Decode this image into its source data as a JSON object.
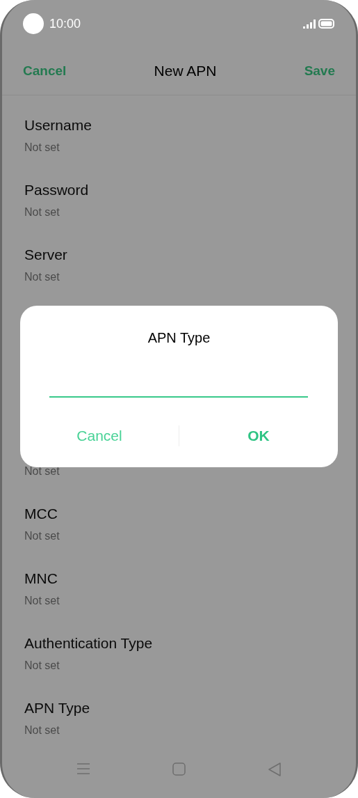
{
  "status_bar": {
    "time": "10:00"
  },
  "header": {
    "cancel": "Cancel",
    "title": "New APN",
    "save": "Save"
  },
  "fields": [
    {
      "title": "Username",
      "value": "Not set"
    },
    {
      "title": "Password",
      "value": "Not set"
    },
    {
      "title": "Server",
      "value": "Not set"
    },
    {
      "value": "Not set"
    },
    {
      "title": "MCC",
      "value": "Not set"
    },
    {
      "title": "MNC",
      "value": "Not set"
    },
    {
      "title": "Authentication Type",
      "value": "Not set"
    },
    {
      "title": "APN Type",
      "value": "Not set"
    }
  ],
  "dialog": {
    "title": "APN Type",
    "buttons": [
      {
        "label": "Cancel",
        "kind": "secondary"
      },
      {
        "label": "OK",
        "kind": "primary"
      }
    ]
  }
}
